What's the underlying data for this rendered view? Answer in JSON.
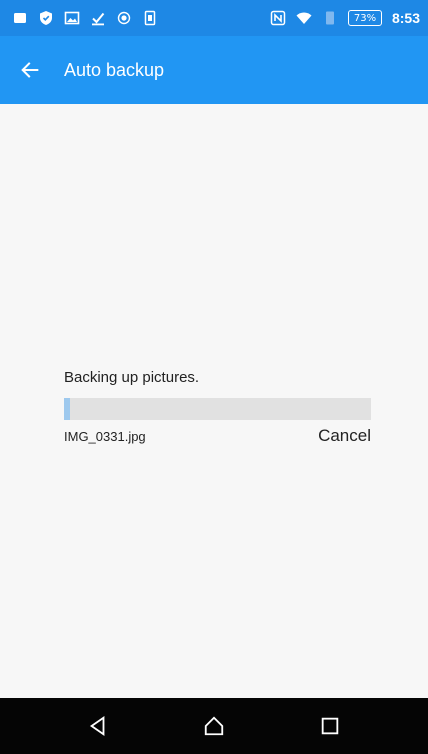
{
  "status_bar": {
    "battery_percent": "73%",
    "time": "8:53",
    "icons": [
      "stop-icon",
      "shield-icon",
      "image-icon",
      "download-icon",
      "record-icon",
      "sim-icon",
      "nfc-icon",
      "wifi-icon",
      "phone-icon"
    ]
  },
  "app_bar": {
    "title": "Auto backup",
    "back_icon": "arrow-left-icon"
  },
  "progress": {
    "label": "Backing up pictures.",
    "file_name": "IMG_0331.jpg",
    "cancel_label": "Cancel",
    "fraction": 0.01
  },
  "nav_bar": {
    "icons": [
      "back-triangle-icon",
      "home-icon",
      "recents-icon"
    ]
  },
  "colors": {
    "status_bar": "#1e88e5",
    "app_bar": "#2196f3",
    "background": "#f7f7f7",
    "track": "#e1e1e1",
    "nav_bar": "#050505"
  }
}
